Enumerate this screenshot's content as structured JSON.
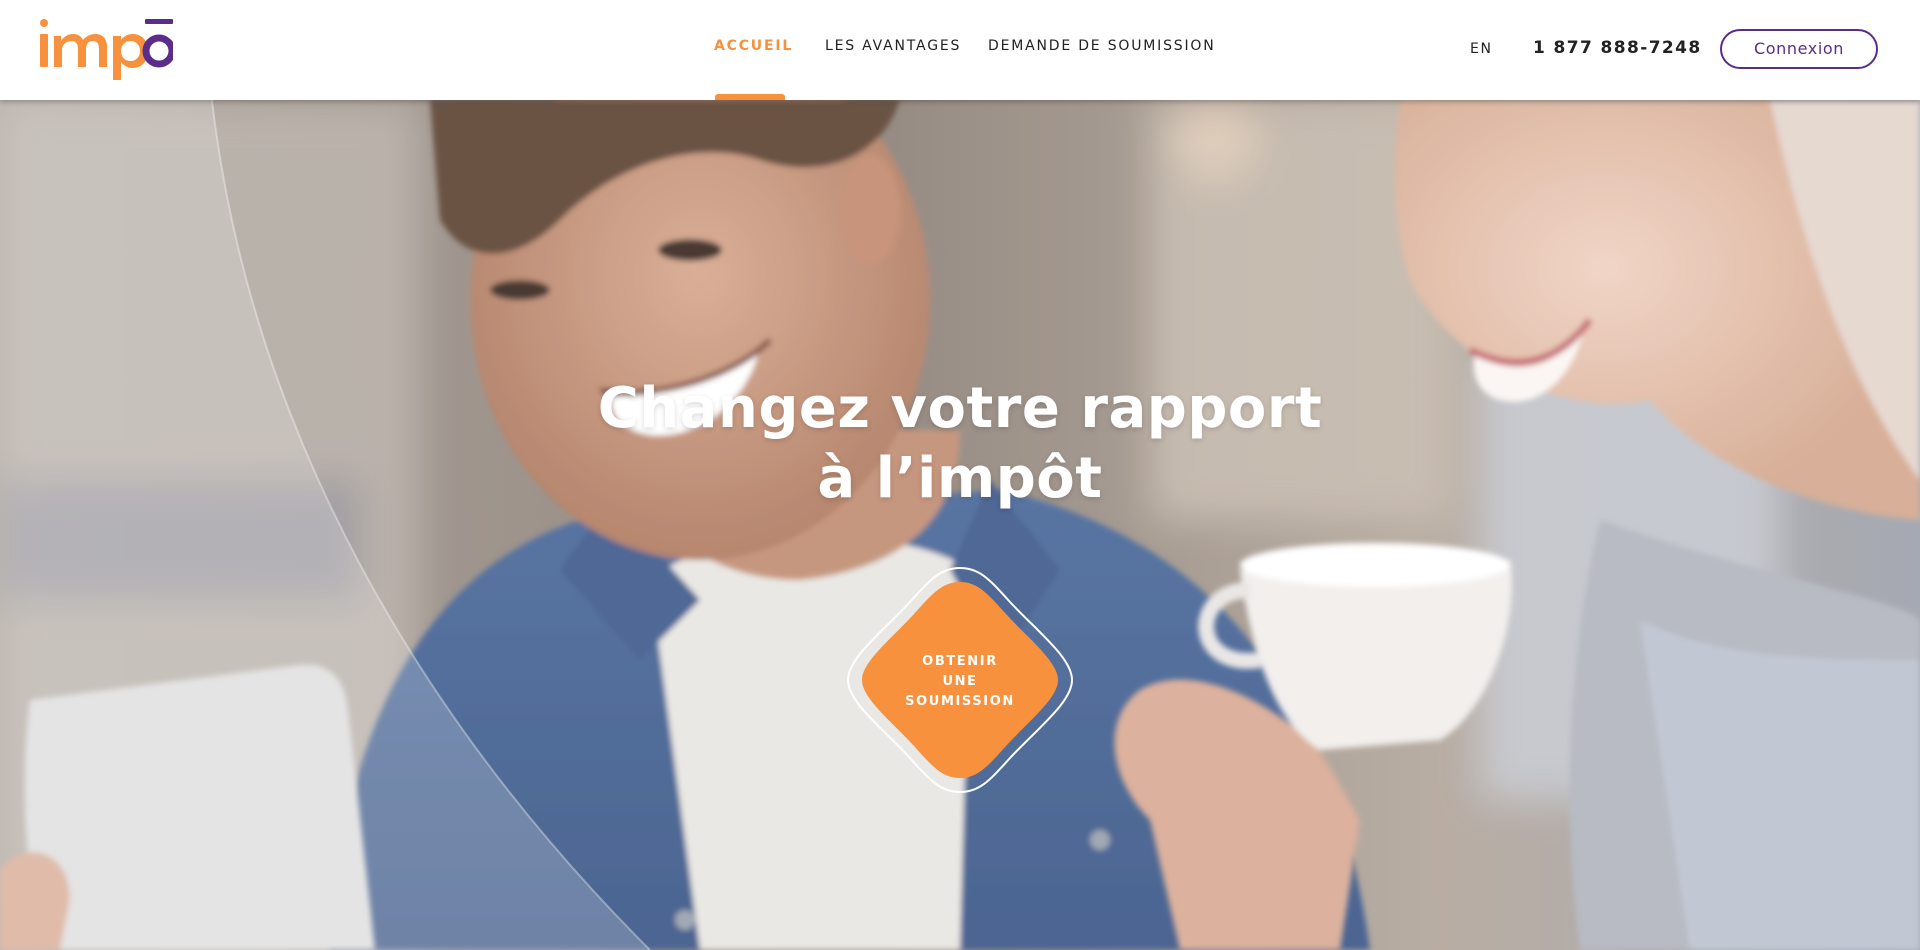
{
  "brand": {
    "logo_text": "impo",
    "accent_color": "#f7913d",
    "brand_purple": "#5a2d8a"
  },
  "nav": {
    "items": [
      {
        "label": "ACCUEIL",
        "active": true
      },
      {
        "label": "LES AVANTAGES",
        "active": false
      },
      {
        "label": "DEMANDE DE SOUMISSION",
        "active": false
      }
    ]
  },
  "header_right": {
    "language": "EN",
    "phone": "1 877 888-7248",
    "login_label": "Connexion"
  },
  "hero": {
    "title_line1": "Changez votre rapport",
    "title_line2": "à l’impôt",
    "cta_lines": [
      "OBTENIR",
      "UNE",
      "SOUMISSION"
    ],
    "background_icon": "photo-people-coffee"
  }
}
